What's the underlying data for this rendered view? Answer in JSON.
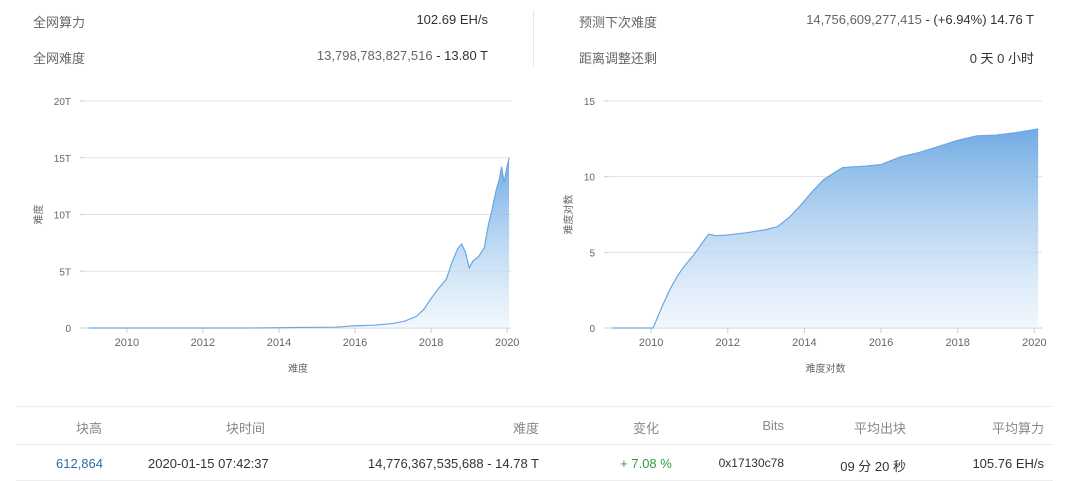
{
  "stats": {
    "hashrate_label": "全网算力",
    "hashrate_value": "102.69 EH/s",
    "difficulty_label": "全网难度",
    "difficulty_value": "13,798,783,827,516",
    "difficulty_short": " - 13.80 T",
    "next_difficulty_label": "预测下次难度",
    "next_difficulty_value": "14,756,609,277,415",
    "next_difficulty_change": " - (+6.94%) 14.76 T",
    "adjust_label": "距离调整还剩",
    "adjust_value": "0 天 0 小时"
  },
  "chart_data": [
    {
      "type": "area",
      "title": "",
      "xlabel": "难度",
      "ylabel": "难度",
      "xlim": [
        2008.9,
        2020.1
      ],
      "ylim": [
        0,
        20
      ],
      "ytick_labels": [
        "0",
        "5T",
        "10T",
        "15T",
        "20T"
      ],
      "ytick_values": [
        0,
        5,
        10,
        15,
        20
      ],
      "xtick_labels": [
        "2010",
        "2012",
        "2014",
        "2016",
        "2018",
        "2020"
      ],
      "xtick_values": [
        2010,
        2012,
        2014,
        2016,
        2018,
        2020
      ],
      "grid": true,
      "color": "#7fb3e6",
      "x": [
        2009.0,
        2010.0,
        2011.0,
        2012.0,
        2013.0,
        2014.0,
        2014.5,
        2015.0,
        2015.5,
        2016.0,
        2016.5,
        2017.0,
        2017.3,
        2017.6,
        2017.8,
        2018.0,
        2018.2,
        2018.4,
        2018.55,
        2018.7,
        2018.8,
        2018.9,
        2019.0,
        2019.1,
        2019.25,
        2019.4,
        2019.5,
        2019.6,
        2019.7,
        2019.8,
        2019.85,
        2019.92,
        2019.97,
        2020.05
      ],
      "y": [
        0,
        0,
        0,
        0,
        0,
        0.02,
        0.05,
        0.06,
        0.07,
        0.2,
        0.25,
        0.4,
        0.6,
        1.0,
        1.6,
        2.6,
        3.5,
        4.3,
        5.8,
        7.0,
        7.4,
        6.7,
        5.3,
        5.9,
        6.3,
        7.1,
        9.0,
        10.4,
        12.0,
        13.2,
        14.2,
        12.8,
        13.8,
        15.0
      ]
    },
    {
      "type": "area",
      "title": "",
      "xlabel": "难度对数",
      "ylabel": "难度对数",
      "xlim": [
        2008.9,
        2020.2
      ],
      "ylim": [
        0,
        15
      ],
      "ytick_labels": [
        "0",
        "5",
        "10",
        "15"
      ],
      "ytick_values": [
        0,
        5,
        10,
        15
      ],
      "xtick_labels": [
        "2010",
        "2012",
        "2014",
        "2016",
        "2018",
        "2020"
      ],
      "xtick_values": [
        2010,
        2012,
        2014,
        2016,
        2018,
        2020
      ],
      "grid": true,
      "color": "#7fb3e6",
      "x": [
        2009.0,
        2010.05,
        2010.15,
        2010.3,
        2010.5,
        2010.7,
        2010.9,
        2011.1,
        2011.3,
        2011.5,
        2011.7,
        2012.0,
        2012.5,
        2013.0,
        2013.3,
        2013.6,
        2013.9,
        2014.2,
        2014.5,
        2014.8,
        2015.0,
        2015.3,
        2015.6,
        2016.0,
        2016.5,
        2017.0,
        2017.5,
        2018.0,
        2018.5,
        2019.0,
        2019.5,
        2020.1
      ],
      "y": [
        0,
        0,
        0.6,
        1.5,
        2.6,
        3.5,
        4.2,
        4.8,
        5.5,
        6.2,
        6.1,
        6.15,
        6.3,
        6.5,
        6.7,
        7.3,
        8.1,
        9.0,
        9.8,
        10.3,
        10.6,
        10.65,
        10.7,
        10.8,
        11.3,
        11.6,
        12.0,
        12.4,
        12.7,
        12.75,
        12.9,
        13.15
      ]
    }
  ],
  "table": {
    "headers": [
      "块高",
      "块时间",
      "难度",
      "变化",
      "Bits",
      "平均出块",
      "平均算力"
    ],
    "row": {
      "height": "612,864",
      "time": "2020-01-15 07:42:37",
      "difficulty": "14,776,367,535,688 - 14.78 T",
      "change": "+ 7.08 %",
      "bits": "0x17130c78",
      "avg_block": "09 分 20 秒",
      "avg_hashrate": "105.76 EH/s"
    }
  }
}
